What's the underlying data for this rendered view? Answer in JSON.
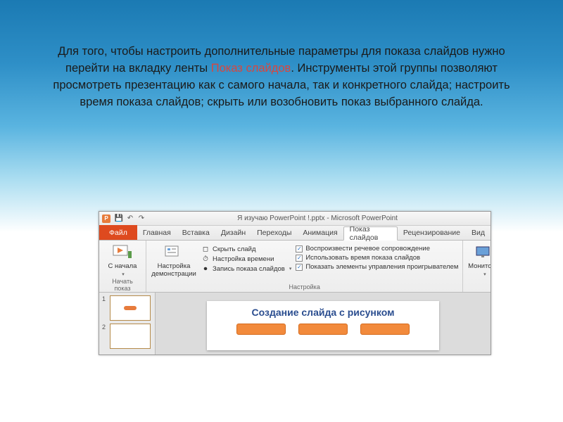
{
  "slide_text": {
    "part1": "Для того, чтобы настроить дополнительные параметры для показа слайдов нужно перейти на вкладку ленты ",
    "highlight": "Показ слайдов",
    "part2": ". Инструменты этой группы позволяют просмотреть презентацию как с самого начала, так и конкретного слайда; настроить время показа слайдов; скрыть или возобновить показ выбранного слайда."
  },
  "powerpoint": {
    "app_letter": "P",
    "title": "Я изучаю PowerPoint !.pptx  -  Microsoft PowerPoint",
    "tabs": {
      "file": "Файл",
      "home": "Главная",
      "insert": "Вставка",
      "design": "Дизайн",
      "transitions": "Переходы",
      "animation": "Анимация",
      "slideshow": "Показ слайдов",
      "review": "Рецензирование",
      "view": "Вид"
    },
    "ribbon": {
      "start_group": {
        "from_start": "С начала",
        "label": "Начать показ слайдов"
      },
      "setup_group": {
        "setup_btn": "Настройка демонстрации",
        "hide_slide": "Скрыть слайд",
        "rehearse": "Настройка времени",
        "record": "Запись показа слайдов",
        "play_narration": "Воспроизвести речевое сопровождение",
        "use_timings": "Использовать время показа слайдов",
        "show_controls": "Показать элементы управления проигрывателем",
        "label": "Настройка"
      },
      "monitors_group": {
        "monitors": "Мониторы"
      }
    },
    "thumbs": {
      "n1": "1",
      "n2": "2"
    },
    "preview_title": "Создание слайда с рисунком"
  },
  "checkmark": "✓",
  "dropdown": "▾"
}
